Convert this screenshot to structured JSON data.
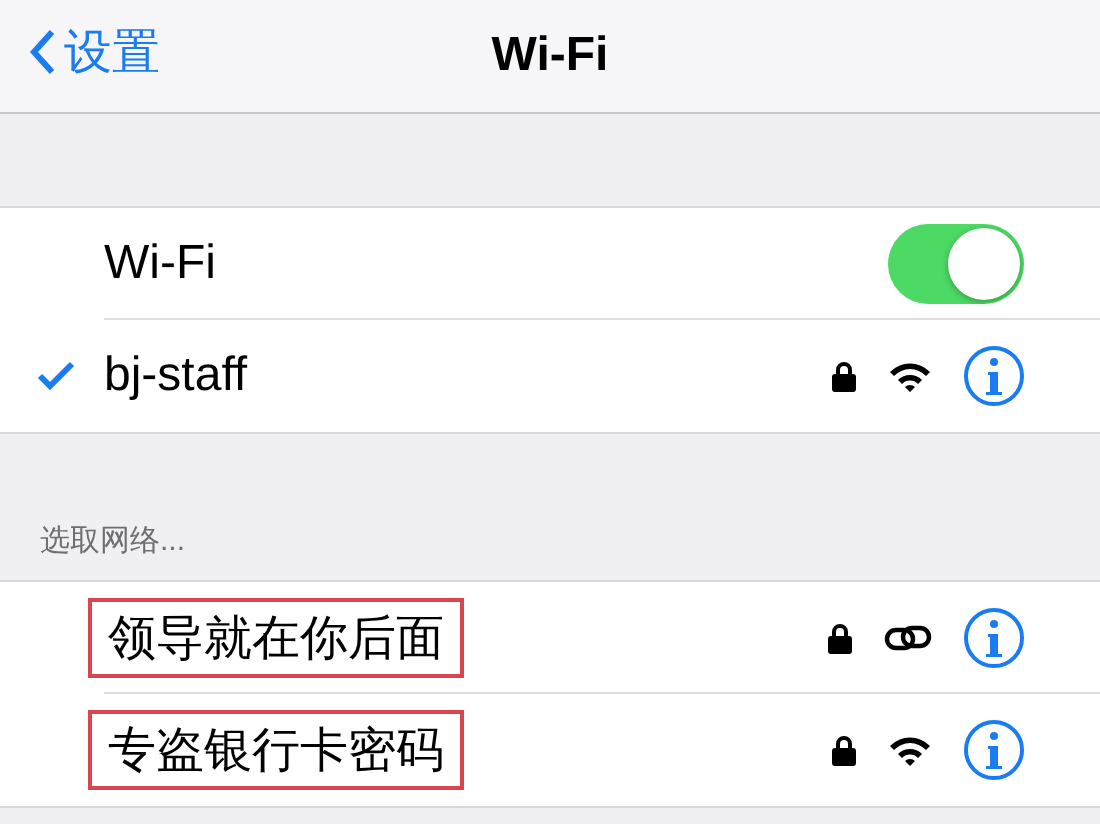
{
  "nav": {
    "back": "设置",
    "title": "Wi-Fi"
  },
  "wifi_toggle": {
    "label": "Wi-Fi",
    "on": true
  },
  "connected": {
    "name": "bj-staff",
    "selected": true,
    "locked": true,
    "kind": "wifi"
  },
  "section_header": "选取网络...",
  "networks": [
    {
      "name": "领导就在你后面",
      "highlighted": true,
      "locked": true,
      "kind": "hotspot"
    },
    {
      "name": "专盗银行卡密码",
      "highlighted": true,
      "locked": true,
      "kind": "wifi"
    }
  ]
}
